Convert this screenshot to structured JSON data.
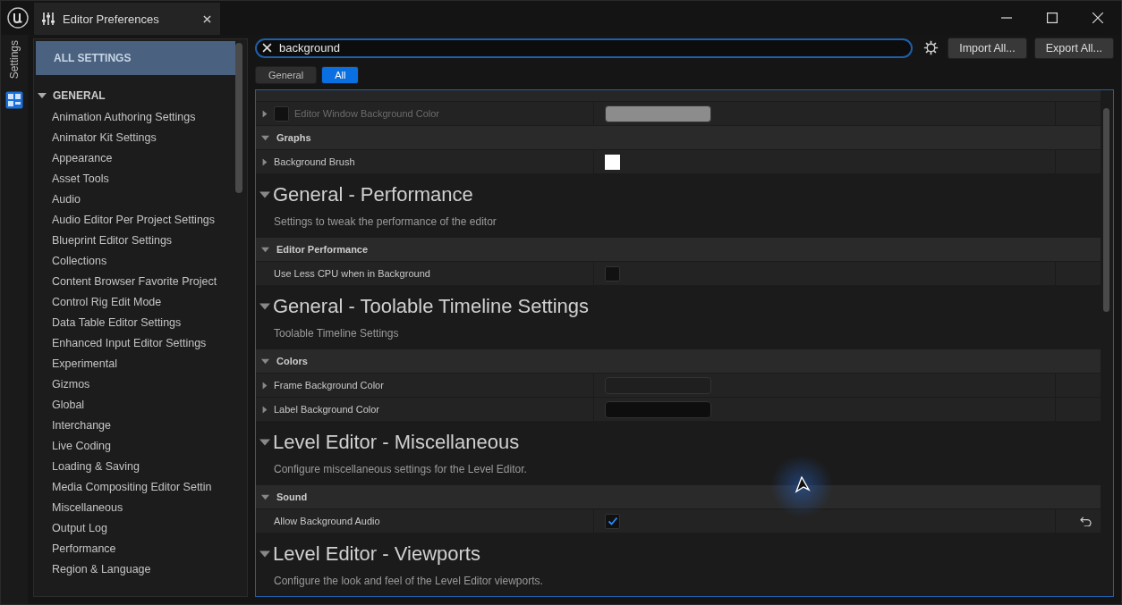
{
  "window": {
    "tab_title": "Editor Preferences",
    "side_tab": "Settings"
  },
  "sidebar": {
    "all_settings": {
      "label": "ALL SETTINGS",
      "selected": true
    },
    "group": {
      "label": "GENERAL",
      "expanded": true
    },
    "items": [
      {
        "label": "Animation Authoring Settings"
      },
      {
        "label": "Animator Kit Settings"
      },
      {
        "label": "Appearance"
      },
      {
        "label": "Asset Tools"
      },
      {
        "label": "Audio"
      },
      {
        "label": "Audio Editor Per Project Settings"
      },
      {
        "label": "Blueprint Editor Settings"
      },
      {
        "label": "Collections"
      },
      {
        "label": "Content Browser Favorite Project"
      },
      {
        "label": "Control Rig Edit Mode"
      },
      {
        "label": "Data Table Editor Settings"
      },
      {
        "label": "Enhanced Input Editor Settings"
      },
      {
        "label": "Experimental"
      },
      {
        "label": "Gizmos"
      },
      {
        "label": "Global"
      },
      {
        "label": "Interchange"
      },
      {
        "label": "Live Coding"
      },
      {
        "label": "Loading & Saving"
      },
      {
        "label": "Media Compositing Editor Settin"
      },
      {
        "label": "Miscellaneous"
      },
      {
        "label": "Output Log"
      },
      {
        "label": "Performance"
      },
      {
        "label": "Region & Language"
      }
    ]
  },
  "search": {
    "value": "background"
  },
  "buttons": [
    "Import All...",
    "Export All..."
  ],
  "tabs": [
    {
      "label": "General",
      "selected": false
    },
    {
      "label": "All",
      "selected": true
    }
  ],
  "content": [
    {
      "kind": "cut"
    },
    {
      "kind": "property",
      "label": "Editor Window Background Color",
      "disabled": true,
      "has_toggle": true,
      "value": {
        "kind": "color",
        "color": "#8c8c8c",
        "wide": true
      }
    },
    {
      "kind": "category",
      "label": "Graphs"
    },
    {
      "kind": "property",
      "label": "Background Brush",
      "disabled": false,
      "has_toggle": false,
      "value": {
        "kind": "color",
        "color": "#ffffff",
        "wide": false
      }
    },
    {
      "kind": "section",
      "title": "General - Performance",
      "description": "Settings to tweak the performance of the editor"
    },
    {
      "kind": "category",
      "label": "Editor Performance"
    },
    {
      "kind": "property",
      "label": "Use Less CPU when in Background",
      "disabled": false,
      "has_toggle": false,
      "value": {
        "kind": "checkbox",
        "checked": false
      }
    },
    {
      "kind": "section",
      "title": "General - Toolable Timeline Settings",
      "description": "Toolable Timeline Settings"
    },
    {
      "kind": "category",
      "label": "Colors"
    },
    {
      "kind": "property",
      "label": "Frame Background Color",
      "disabled": false,
      "has_toggle": false,
      "value": {
        "kind": "color",
        "color": "#1f1f1f",
        "wide": true
      }
    },
    {
      "kind": "property",
      "label": "Label Background Color",
      "disabled": false,
      "has_toggle": false,
      "value": {
        "kind": "color",
        "color": "#0e0e0e",
        "wide": true
      }
    },
    {
      "kind": "section",
      "title": "Level Editor - Miscellaneous",
      "description": "Configure miscellaneous settings for the Level Editor."
    },
    {
      "kind": "category",
      "label": "Sound"
    },
    {
      "kind": "property",
      "label": "Allow Background Audio",
      "disabled": false,
      "has_toggle": false,
      "reset": true,
      "value": {
        "kind": "checkbox",
        "checked": true
      }
    },
    {
      "kind": "section",
      "title": "Level Editor - Viewports",
      "description": "Configure the look and feel of the Level Editor viewports."
    }
  ]
}
